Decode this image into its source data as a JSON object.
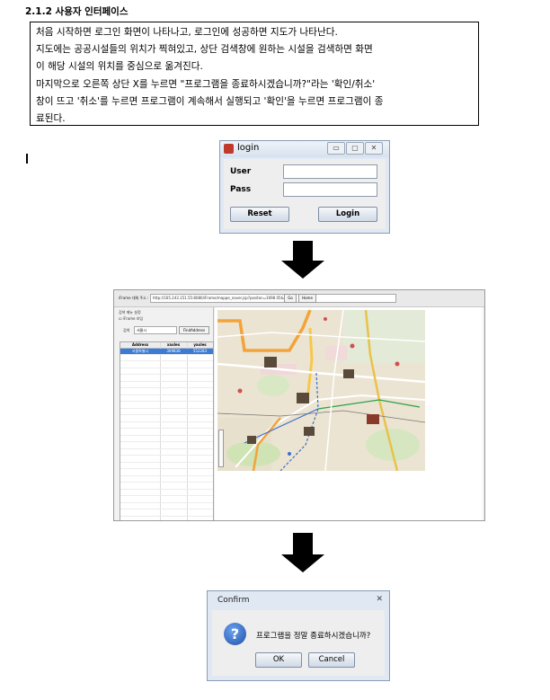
{
  "heading": "2.1.2 사용자 인터페이스",
  "paragraph_lines": [
    "  처음 시작하면 로그인 화면이 나타나고, 로그인에 성공하면 지도가 나타난다.",
    "  지도에는 공공시설들의 위치가 찍혀있고, 상단 검색창에 원하는 시설을 검색하면 화면",
    "이 해당 시설의 위치를 중심으로 옮겨진다.",
    "  마지막으로 오른쪽 상단 X를 누르면 \"프로그램을 종료하시겠습니까?\"라는 '확인/취소'",
    "창이 뜨고 '취소'를 누르면 프로그램이 계속해서 실행되고 '확인'을 누르면 프로그램이 종",
    "료된다."
  ],
  "login_window": {
    "title": "login",
    "user_label": "User",
    "pass_label": "Pass",
    "user_value": "",
    "pass_value": "",
    "reset_label": "Reset",
    "login_label": "Login",
    "controls": [
      "▭",
      "▢",
      "✕"
    ]
  },
  "map_window": {
    "url_label": "iFrame 대체 주소 :",
    "url_value": "http://165.243.151.55:8080/iFrame/mappe_naver.jsp?positon=3098 05&point",
    "go_label": "Go",
    "home_label": "Home",
    "option_label": "검색 메뉴 설정",
    "iframe_check_label": "iFrame 보임",
    "search_label": "검색",
    "search_value": "서울시",
    "find_button": "FindAddress",
    "table_headers": [
      "Address",
      "xaxles",
      "yaxles"
    ],
    "table_rows": [
      [
        "서울특별시",
        "309838",
        "552283"
      ]
    ]
  },
  "confirm_window": {
    "title": "Confirm",
    "close_glyph": "✕",
    "icon_glyph": "?",
    "message": "프로그램을 정말 종료하시겠습니까?",
    "ok_label": "OK",
    "cancel_label": "Cancel"
  }
}
